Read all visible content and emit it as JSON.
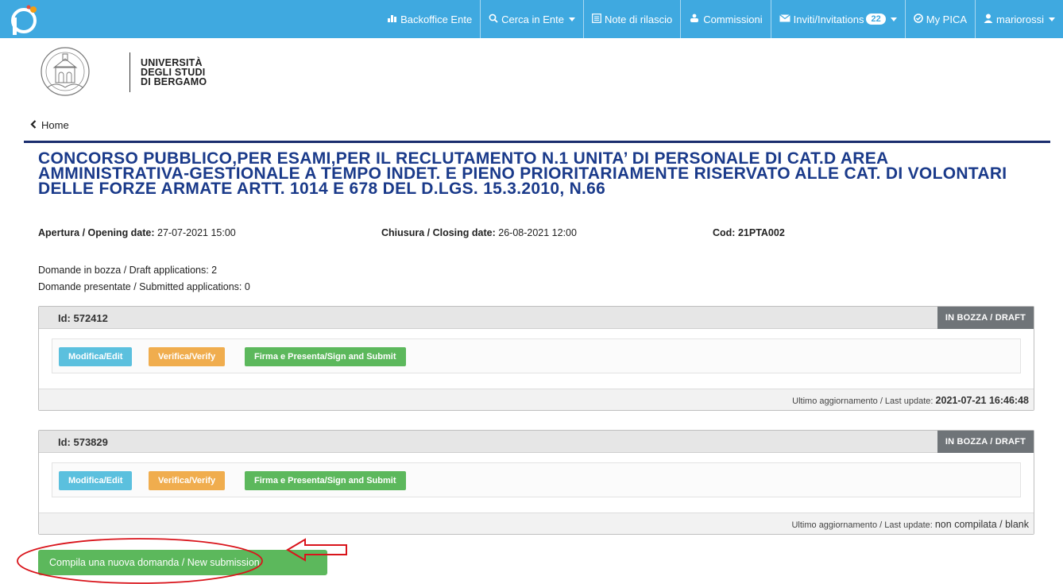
{
  "navbar": {
    "items": [
      {
        "label": "Backoffice Ente",
        "icon": "bar-chart-icon"
      },
      {
        "label": "Cerca in Ente",
        "icon": "search-icon"
      },
      {
        "label": "Note di rilascio",
        "icon": "list-icon"
      },
      {
        "label": "Commissioni",
        "icon": "group-icon"
      },
      {
        "label": "Inviti/Invitations",
        "icon": "envelope-icon",
        "badge": "22"
      },
      {
        "label": "My PICA",
        "icon": "circle-check-icon"
      },
      {
        "label": "mariorossi",
        "icon": "user-icon"
      }
    ]
  },
  "institution": {
    "line1": "UNIVERSITÀ",
    "line2": "DEGLI STUDI",
    "line3": "DI BERGAMO"
  },
  "breadcrumb": {
    "home": "Home"
  },
  "call": {
    "title": "CONCORSO PUBBLICO,PER ESAMI,PER IL RECLUTAMENTO N.1 UNITA’ DI PERSONALE DI CAT.D AREA AMMINISTRATIVA-GESTIONALE A TEMPO INDET. E PIENO PRIORITARIAMENTE RISERVATO ALLE CAT. DI VOLONTARI DELLE FORZE ARMATE ARTT. 1014 E 678 DEL D.LGS. 15.3.2010, N.66",
    "opening_label": "Apertura / Opening date:",
    "opening_value": "27-07-2021 15:00",
    "closing_label": "Chiusura / Closing date:",
    "closing_value": "26-08-2021 12:00",
    "code_label": "Cod:",
    "code_value": "21PTA002"
  },
  "counts": {
    "draft": "Domande in bozza / Draft applications: 2",
    "submitted": "Domande presentate / Submitted applications: 0"
  },
  "applications": [
    {
      "id": "Id: 572412",
      "status": "IN BOZZA / DRAFT",
      "buttons": {
        "edit": "Modifica/Edit",
        "verify": "Verifica/Verify",
        "sign": "Firma e Presenta/Sign and Submit"
      },
      "update_label": "Ultimo aggiornamento / Last update:",
      "update_value": "2021-07-21 16:46:48"
    },
    {
      "id": "Id: 573829",
      "status": "IN BOZZA / DRAFT",
      "buttons": {
        "edit": "Modifica/Edit",
        "verify": "Verifica/Verify",
        "sign": "Firma e Presenta/Sign and Submit"
      },
      "update_label": "Ultimo aggiornamento / Last update:",
      "update_value": "non compilata / blank"
    }
  ],
  "new_submission": {
    "label": "Compila una nuova domanda / New submission"
  },
  "colors": {
    "navbar": "#3fa9e0",
    "title": "#1a3a8a",
    "edit": "#5bc0de",
    "verify": "#f0ad4e",
    "sign": "#5cb85c",
    "annotation": "#d9141b"
  }
}
